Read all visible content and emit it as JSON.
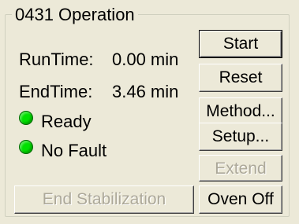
{
  "group": {
    "title": "0431 Operation"
  },
  "info": {
    "runtime_label": "RunTime:",
    "runtime_value": "0.00 min",
    "endtime_label": "EndTime:",
    "endtime_value": "3.46 min"
  },
  "status": {
    "items": [
      {
        "label": "Ready",
        "color": "#00e000",
        "icon": "green-status-led"
      },
      {
        "label": "No Fault",
        "color": "#00e000",
        "icon": "green-status-led"
      }
    ]
  },
  "buttons": {
    "start": "Start",
    "reset": "Reset",
    "method": "Method...",
    "setup": "Setup...",
    "extend": "Extend",
    "end_stabilization": "End Stabilization",
    "oven_off": "Oven Off"
  }
}
